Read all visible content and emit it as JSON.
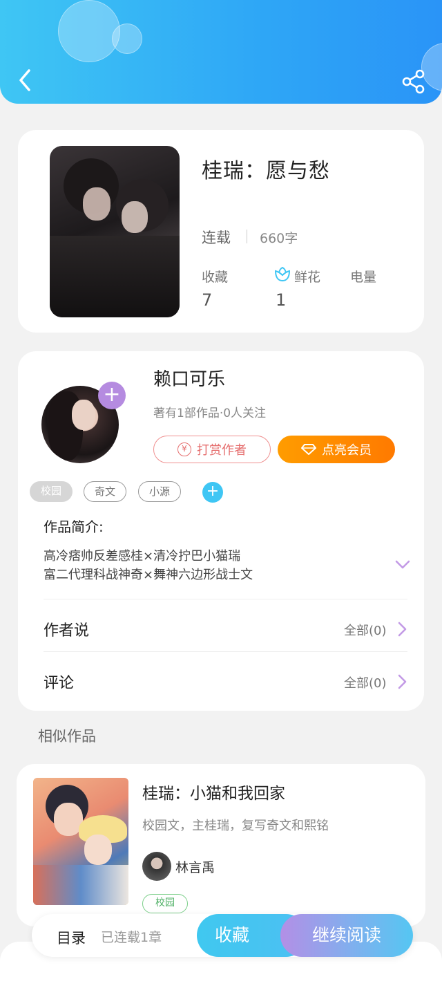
{
  "header": {
    "back_icon": "chevron-left-icon",
    "share_icon": "share-icon"
  },
  "book": {
    "title": "桂瑞：愿与愁",
    "status": "连载",
    "word_count": "660字",
    "stats": [
      {
        "label": "收藏",
        "value": "7"
      },
      {
        "label": "鲜花",
        "value": "1",
        "icon": "flower-icon"
      },
      {
        "label": "电量",
        "value": ""
      }
    ]
  },
  "author": {
    "name": "赖口可乐",
    "meta": "著有1部作品·0人关注",
    "tip_button": "打赏作者",
    "vip_button": "点亮会员",
    "follow_icon": "plus-icon"
  },
  "tags": [
    {
      "label": "校园",
      "active": true
    },
    {
      "label": "奇文",
      "active": false
    },
    {
      "label": "小源",
      "active": false
    }
  ],
  "intro": {
    "label": "作品简介:",
    "lines": [
      "高冷痞帅反差感桂×清冷拧巴小猫瑞",
      "富二代理科战神奇×舞神六边形战士文"
    ]
  },
  "author_says": {
    "label": "作者说",
    "more": "全部(0)"
  },
  "comments": {
    "label": "评论",
    "more": "全部(0)"
  },
  "similar": {
    "section_title": "相似作品",
    "items": [
      {
        "title": "桂瑞：小猫和我回家",
        "desc": "校园文，主桂瑞，复写奇文和熙铭",
        "author": "林言禹",
        "tag": "校园"
      }
    ]
  },
  "bottom_bar": {
    "toc_label": "目录",
    "toc_status": "已连载1章",
    "collect_button": "收藏",
    "read_button": "继续阅读"
  },
  "colors": {
    "header_start": "#3fc6f4",
    "header_end": "#2a94f7",
    "vip_orange": "#ff8a00",
    "tip_red": "#e56d6d",
    "purple_accent": "#b58be0",
    "tag_green": "#4caf63"
  }
}
